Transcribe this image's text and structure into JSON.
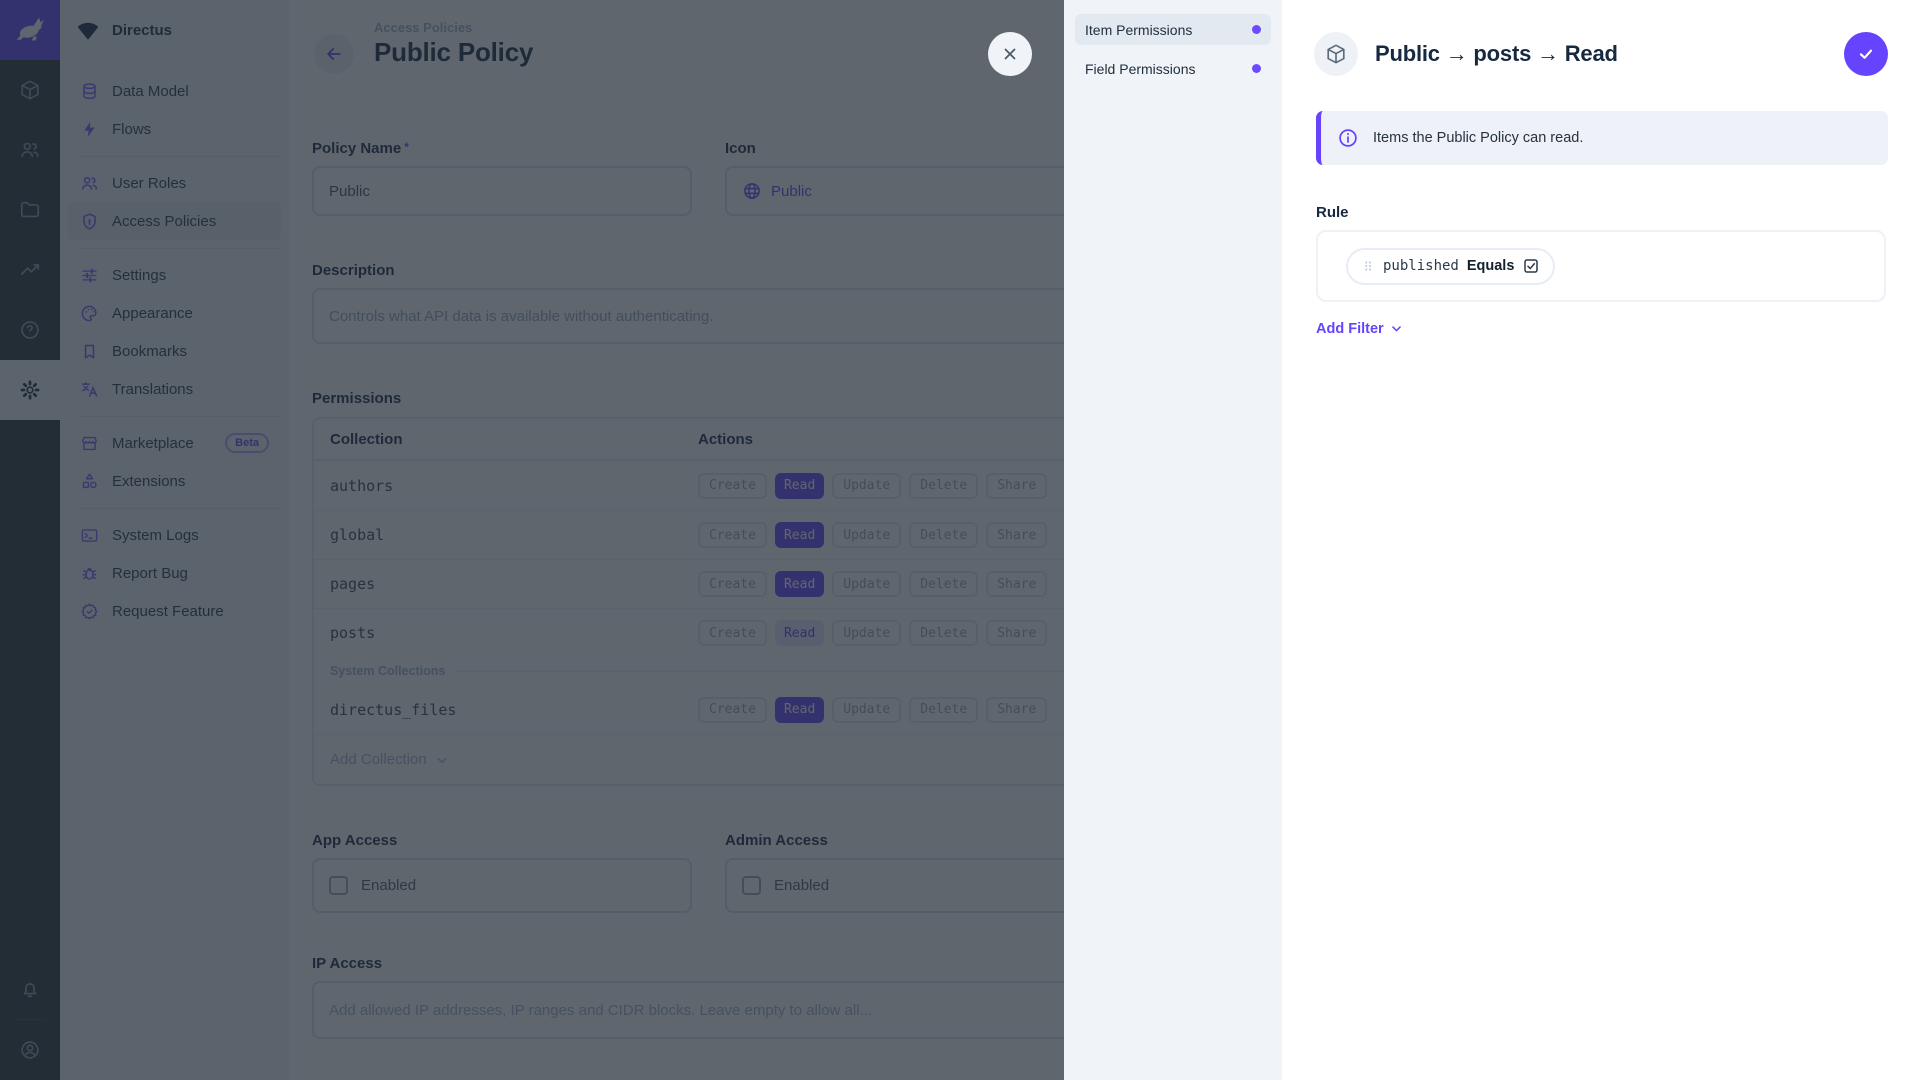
{
  "app": {
    "project_name": "Directus"
  },
  "colors": {
    "accent": "#6644FF",
    "module_bar_bg": "#263238",
    "sidebar_bg": "#F0F4F9",
    "sidebar_active_bg": "#E4EAF1",
    "overlay": "rgba(33,43,54,0.72)",
    "heading_text": "#172940",
    "border": "#D6DFE9",
    "placeholder_text": "#A2B5CD"
  },
  "module_bar": {
    "items": [
      {
        "icon": "cube-icon"
      },
      {
        "icon": "users-icon"
      },
      {
        "icon": "folder-icon"
      },
      {
        "icon": "insights-icon"
      },
      {
        "icon": "help-icon"
      },
      {
        "icon": "gear-icon",
        "active": true
      }
    ],
    "bottom": [
      {
        "icon": "bell-icon"
      },
      {
        "icon": "account-icon"
      }
    ]
  },
  "nav": {
    "sections": [
      {
        "items": [
          {
            "icon": "database-icon",
            "label": "Data Model"
          },
          {
            "icon": "bolt-icon",
            "label": "Flows"
          }
        ]
      },
      {
        "items": [
          {
            "icon": "user-roles-icon",
            "label": "User Roles"
          },
          {
            "icon": "shield-icon",
            "label": "Access Policies",
            "active": true
          }
        ]
      },
      {
        "items": [
          {
            "icon": "tune-icon",
            "label": "Settings"
          },
          {
            "icon": "palette-icon",
            "label": "Appearance"
          },
          {
            "icon": "bookmark-icon",
            "label": "Bookmarks"
          },
          {
            "icon": "translate-icon",
            "label": "Translations"
          }
        ]
      },
      {
        "items": [
          {
            "icon": "storefront-icon",
            "label": "Marketplace",
            "badge": "Beta"
          },
          {
            "icon": "shapes-icon",
            "label": "Extensions"
          }
        ]
      },
      {
        "items": [
          {
            "icon": "terminal-icon",
            "label": "System Logs"
          },
          {
            "icon": "bug-icon",
            "label": "Report Bug"
          },
          {
            "icon": "feature-icon",
            "label": "Request Feature"
          }
        ]
      }
    ]
  },
  "page": {
    "breadcrumb": "Access Policies",
    "title": "Public Policy",
    "fields": {
      "policy_name": {
        "label": "Policy Name",
        "required_mark": "*",
        "value": "Public"
      },
      "icon": {
        "label": "Icon",
        "value": "Public"
      },
      "description": {
        "label": "Description",
        "value": "Controls what API data is available without authenticating."
      },
      "app_access": {
        "label": "App Access",
        "checkbox_label": "Enabled",
        "checked": false
      },
      "admin_access": {
        "label": "Admin Access",
        "checkbox_label": "Enabled",
        "checked": false
      },
      "ip_access": {
        "label": "IP Access",
        "placeholder": "Add allowed IP addresses, IP ranges and CIDR blocks. Leave empty to allow all..."
      }
    },
    "permissions": {
      "label": "Permissions",
      "columns": {
        "collection": "Collection",
        "actions": "Actions"
      },
      "actions": [
        "Create",
        "Read",
        "Update",
        "Delete",
        "Share"
      ],
      "rows": [
        {
          "collection": "authors",
          "active_action": "Read",
          "active_style": "solid"
        },
        {
          "collection": "global",
          "active_action": "Read",
          "active_style": "solid"
        },
        {
          "collection": "pages",
          "active_action": "Read",
          "active_style": "solid"
        },
        {
          "collection": "posts",
          "active_action": "Read",
          "active_style": "subdued"
        },
        {
          "collection": "directus_files",
          "active_action": "Read",
          "active_style": "solid"
        }
      ],
      "system_divider": "System Collections",
      "add_collection": "Add Collection"
    }
  },
  "drawer": {
    "nav": [
      {
        "label": "Item Permissions",
        "active": true
      },
      {
        "label": "Field Permissions",
        "active": false
      }
    ],
    "title": "Public → posts → Read",
    "banner": "Items the Public Policy can read.",
    "rule": {
      "label": "Rule",
      "filter": {
        "field": "published",
        "operator": "Equals",
        "value_checked": true
      },
      "add_filter": "Add Filter"
    }
  }
}
